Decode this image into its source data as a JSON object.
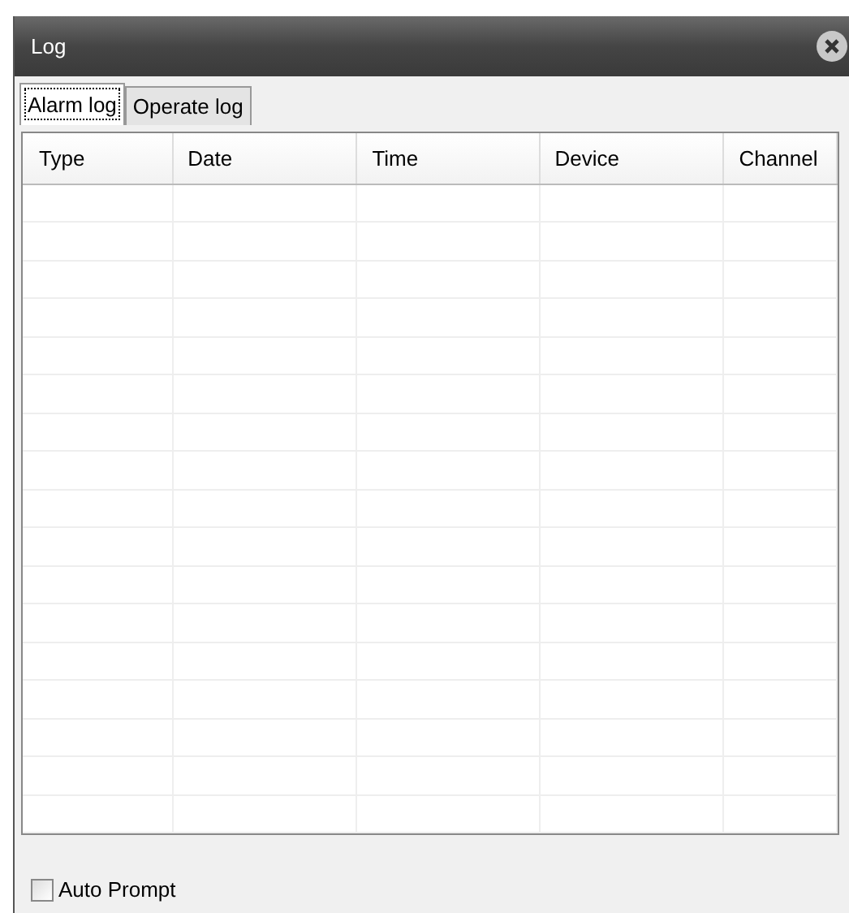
{
  "window": {
    "title": "Log"
  },
  "tabs": [
    {
      "label": "Alarm log",
      "selected": true
    },
    {
      "label": "Operate log",
      "selected": false
    }
  ],
  "table": {
    "columns": [
      "Type",
      "Date",
      "Time",
      "Device",
      "Channel"
    ]
  },
  "auto_prompt": {
    "label": "Auto Prompt",
    "checked": false
  }
}
